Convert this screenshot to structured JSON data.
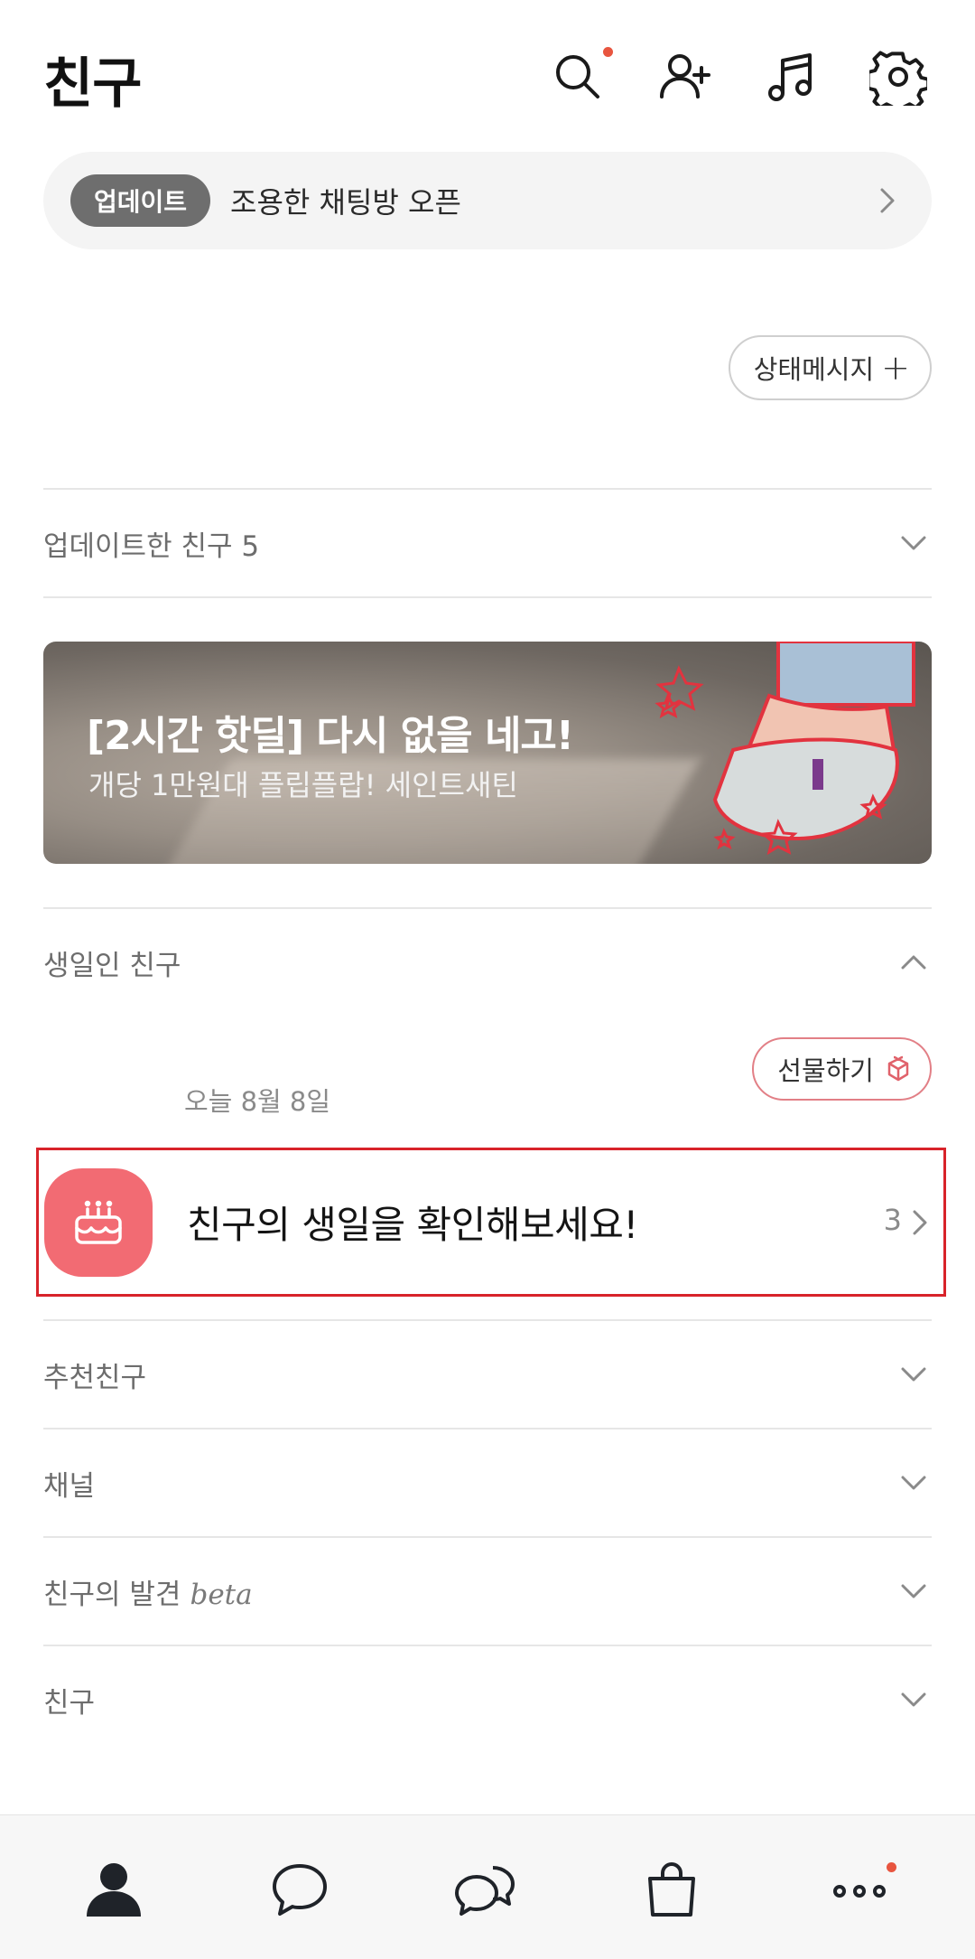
{
  "header": {
    "title": "친구",
    "icons": [
      "search-icon",
      "add-friend-icon",
      "music-icon",
      "settings-icon"
    ],
    "notification_dot_color": "#e8553f"
  },
  "update_banner": {
    "badge": "업데이트",
    "text": "조용한 채팅방 오픈"
  },
  "status_button": {
    "label": "상태메시지",
    "plus": "+"
  },
  "sections": {
    "updated_friends": "업데이트한 친구 5",
    "birthday_friends": "생일인 친구",
    "recommended": "추천친구",
    "channel": "채널",
    "discovery": "친구의 발견",
    "discovery_tag": "beta",
    "friends": "친구"
  },
  "ad": {
    "title": "[2시간 핫딜] 다시 없을 네고!",
    "subtitle": "개당 1만원대 플립플랍! 세인트새틴"
  },
  "birthday": {
    "gift_label": "선물하기",
    "date": "오늘 8월 8일",
    "prompt": "친구의 생일을 확인해보세요!",
    "count": "3"
  },
  "tabbar": {
    "tabs": [
      "friends-tab",
      "chats-tab",
      "openchat-tab",
      "shopping-tab",
      "more-tab"
    ],
    "active": "friends-tab"
  },
  "colors": {
    "accent_red": "#d8232a",
    "birthday_icon_bg": "#f26b73",
    "badge_bg": "#6e6e6e"
  }
}
